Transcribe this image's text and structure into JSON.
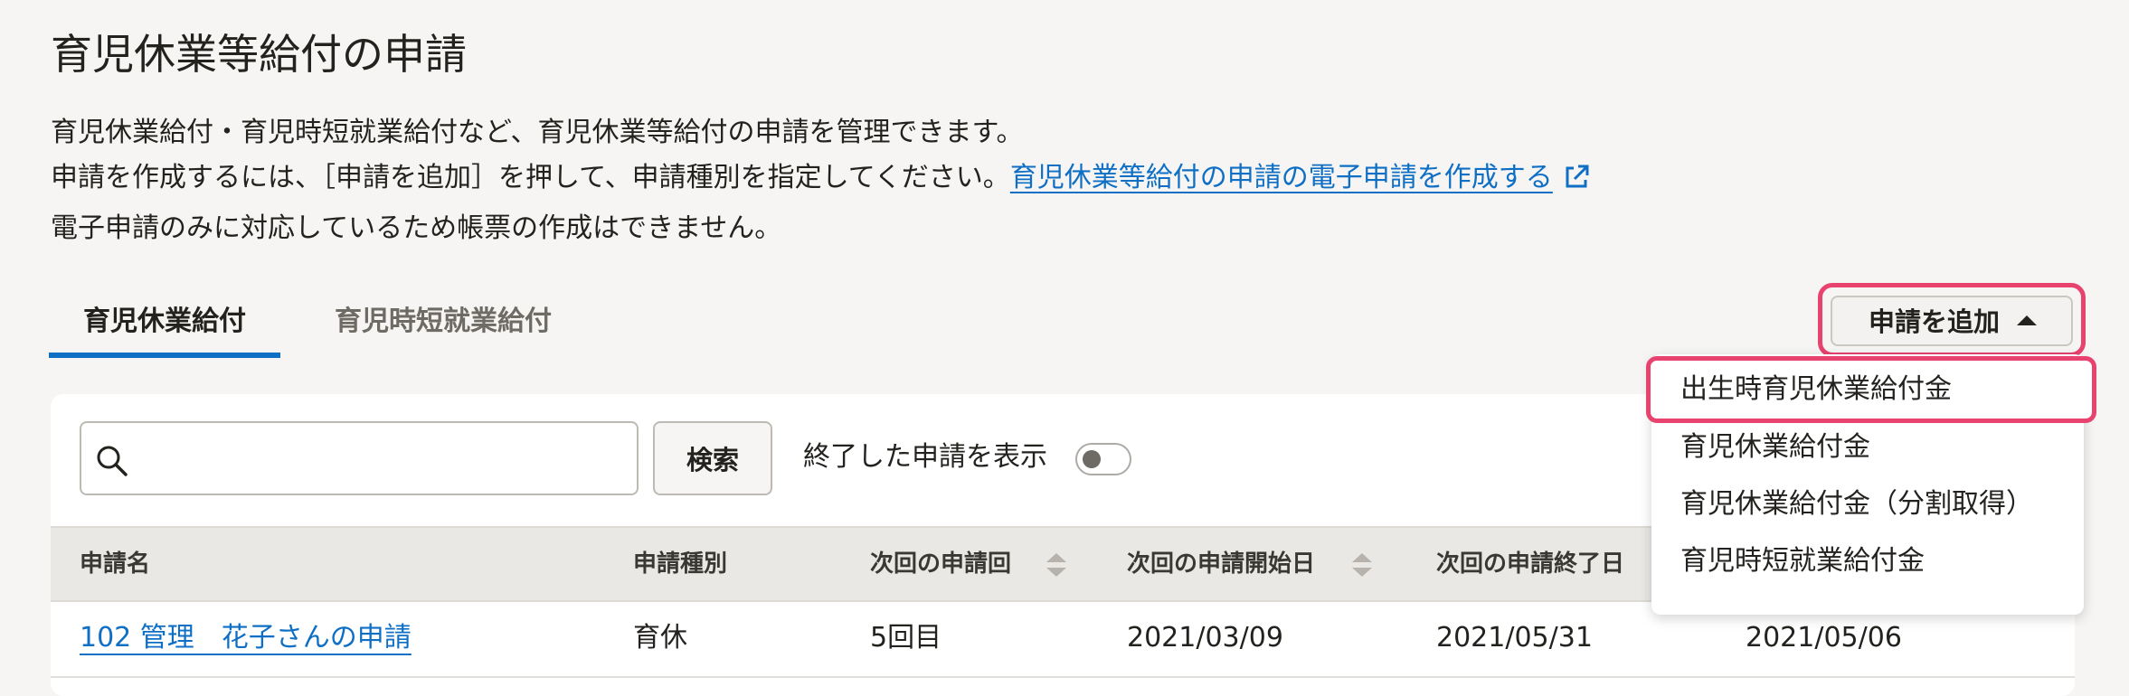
{
  "page": {
    "title": "育児休業等給付の申請",
    "description": {
      "line1": "育児休業給付・育児時短就業給付など、育児休業等給付の申請を管理できます。",
      "line2_text": "申請を作成するには、［申請を追加］を押して、申請種別を指定してください。",
      "line2_link": "育児休業等給付の申請の電子申請を作成する",
      "line3": "電子申請のみに対応しているため帳票の作成はできません。"
    }
  },
  "tabs": [
    {
      "label": "育児休業給付",
      "active": true
    },
    {
      "label": "育児時短就業給付",
      "active": false
    }
  ],
  "toolbar": {
    "add_label": "申請を追加"
  },
  "add_menu": {
    "items": [
      "出生時育児休業給付金",
      "育児休業給付金",
      "育児休業給付金（分割取得）",
      "育児時短就業給付金"
    ]
  },
  "search": {
    "placeholder": "",
    "value": "",
    "button_label": "検索"
  },
  "filter": {
    "show_finished_label": "終了した申請を表示",
    "show_finished": false
  },
  "table": {
    "columns": [
      "申請名",
      "申請種別",
      "次回の申請回",
      "次回の申請開始日",
      "次回の申請終了日"
    ],
    "rows": [
      {
        "name": "102 管理　花子さんの申請",
        "type": "育休",
        "next_round": "5回目",
        "start": "2021/03/09",
        "end": "2021/05/31",
        "deadline": "2021/05/06"
      }
    ]
  },
  "colors": {
    "accent": "#0f6fc5",
    "highlight": "#e8426f",
    "background": "#f6f5f4"
  },
  "icons": {
    "external_link": "external-link-icon",
    "search": "search-icon",
    "caret": "caret-up-icon",
    "sort": "sort-icon"
  }
}
